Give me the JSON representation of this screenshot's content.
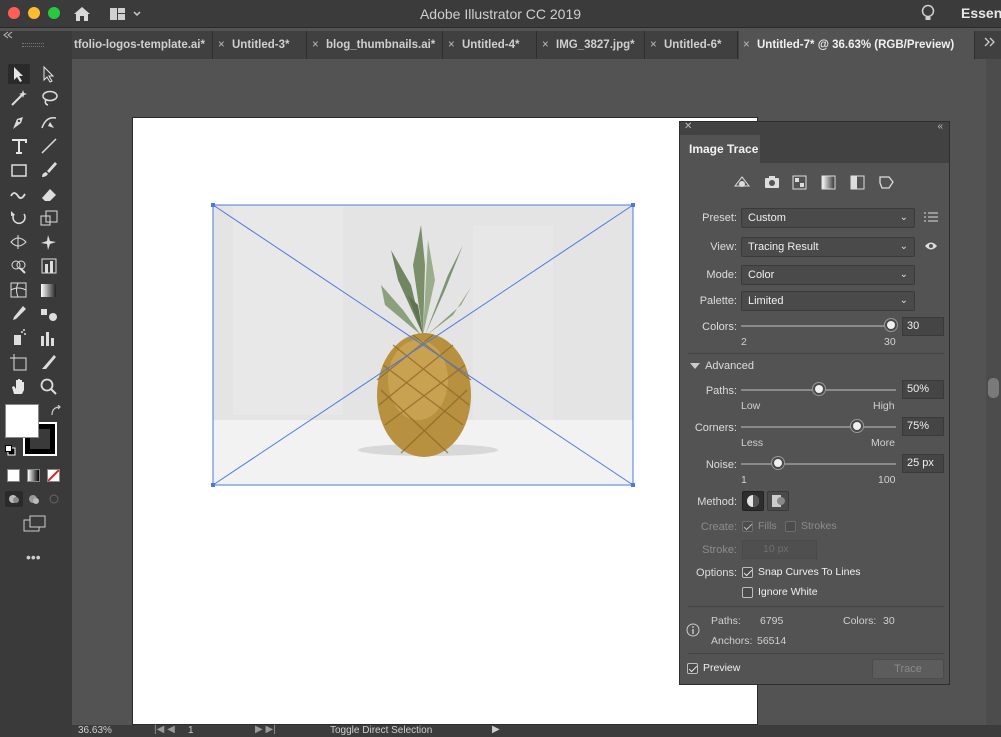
{
  "app": {
    "title": "Adobe Illustrator CC 2019",
    "workspace_label": "Essent"
  },
  "tabs": [
    {
      "label": "tfolio-logos-template.ai*",
      "active": false
    },
    {
      "label": "Untitled-3*",
      "active": false
    },
    {
      "label": "blog_thumbnails.ai*",
      "active": false
    },
    {
      "label": "Untitled-4*",
      "active": false
    },
    {
      "label": "IMG_3827.jpg*",
      "active": false
    },
    {
      "label": "Untitled-6*",
      "active": false
    },
    {
      "label": "Untitled-7* @ 36.63% (RGB/Preview)",
      "active": true
    }
  ],
  "tab_close_glyph": "×",
  "tools": [
    "selection-tool",
    "direct-selection-tool",
    "magic-wand-tool",
    "lasso-tool",
    "pen-tool",
    "curvature-tool",
    "type-tool",
    "line-segment-tool",
    "rectangle-tool",
    "paintbrush-tool",
    "shaper-tool",
    "eraser-tool",
    "rotate-tool",
    "scale-tool",
    "width-tool",
    "puppet-warp-tool",
    "shape-builder-tool",
    "graph-tool",
    "mesh-tool",
    "gradient-tool",
    "eyedropper-tool",
    "blend-tool",
    "symbol-sprayer-tool",
    "column-graph-tool",
    "artboard-tool",
    "slice-tool",
    "hand-tool",
    "zoom-tool"
  ],
  "colors": {
    "fill": "#ffffff",
    "stroke": "#000000",
    "panel_bg": "#535353",
    "selection_blue": "#4a7ae0"
  },
  "image_trace": {
    "panel_title": "Image Trace",
    "preset": {
      "label": "Preset:",
      "value": "Custom"
    },
    "view": {
      "label": "View:",
      "value": "Tracing Result"
    },
    "mode": {
      "label": "Mode:",
      "value": "Color"
    },
    "palette": {
      "label": "Palette:",
      "value": "Limited"
    },
    "colors": {
      "label": "Colors:",
      "value": "30",
      "min": "2",
      "max": "30",
      "level": 1.0
    },
    "advanced_label": "Advanced",
    "paths": {
      "label": "Paths:",
      "value": "50%",
      "min": "Low",
      "max": "High",
      "level": 0.5
    },
    "corners": {
      "label": "Corners:",
      "value": "75%",
      "min": "Less",
      "max": "More",
      "level": 0.75
    },
    "noise": {
      "label": "Noise:",
      "value": "25 px",
      "min": "1",
      "max": "100",
      "level": 0.24
    },
    "method_label": "Method:",
    "create": {
      "label": "Create:",
      "fills": "Fills",
      "strokes": "Strokes",
      "fills_checked": true,
      "strokes_checked": false
    },
    "stroke": {
      "label": "Stroke:",
      "value": "10 px"
    },
    "options": {
      "label": "Options:",
      "snap": "Snap Curves To Lines",
      "snap_checked": true,
      "ignore_white": "Ignore White",
      "ignore_white_checked": false
    },
    "info": {
      "paths_label": "Paths:",
      "paths_value": "6795",
      "colors_label": "Colors:",
      "colors_value": "30",
      "anchors_label": "Anchors:",
      "anchors_value": "56514"
    },
    "preview": {
      "label": "Preview",
      "checked": true
    },
    "trace_button": "Trace"
  },
  "status": {
    "zoom": "36.63%",
    "artboard": "1",
    "tool_hint": "Toggle Direct Selection"
  }
}
